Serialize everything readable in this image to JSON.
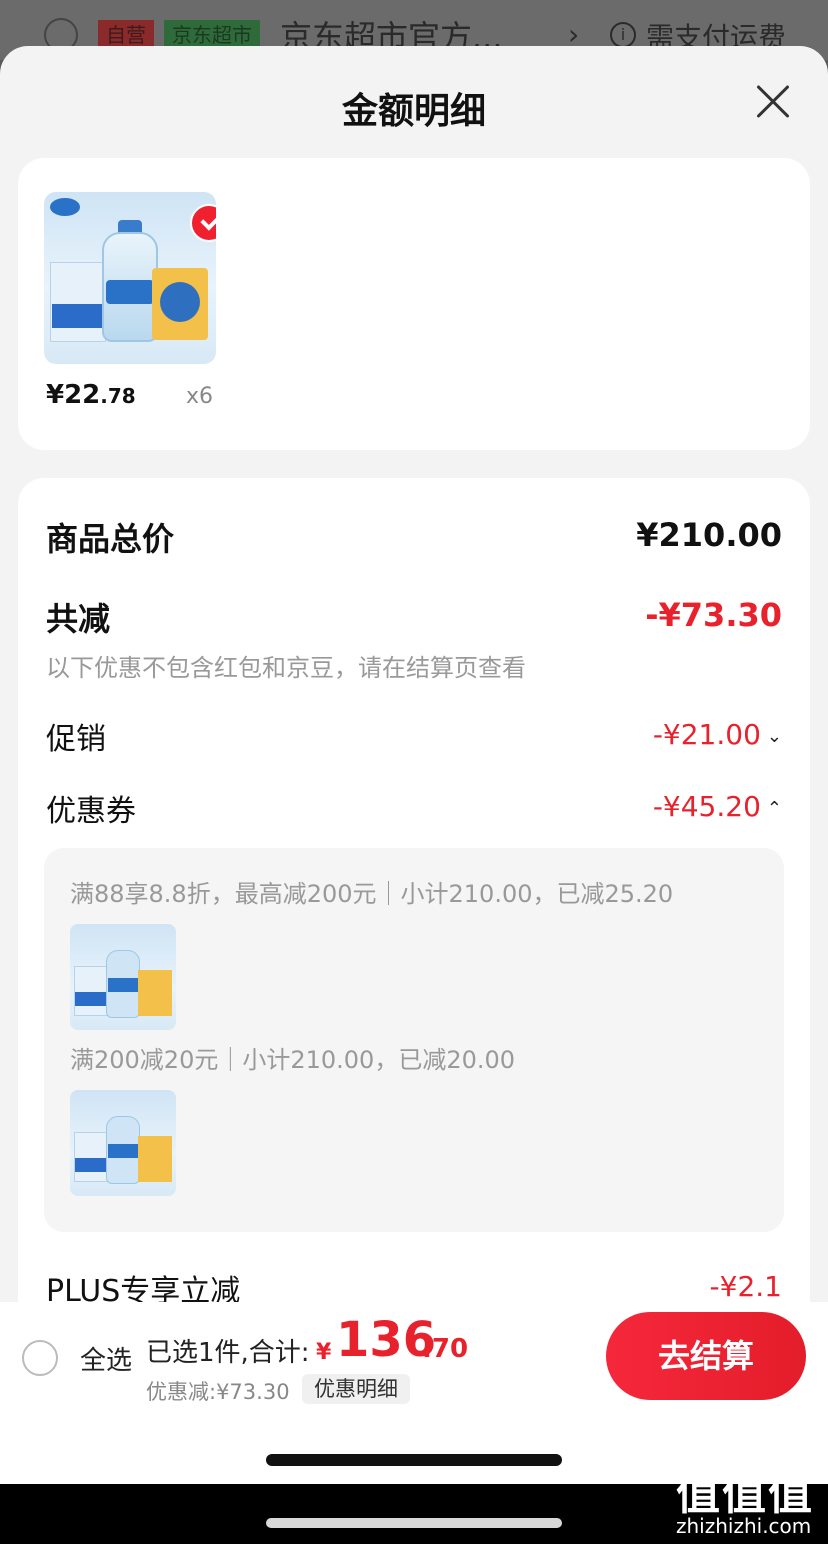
{
  "background": {
    "tag_self": "自营",
    "tag_market": "京东超市",
    "store_name": "京东超市官方...",
    "chevron": "›",
    "info_icon": "i",
    "shipping_note": "需支付运费"
  },
  "sheet": {
    "title": "金额明细",
    "close_icon": "close-icon"
  },
  "product": {
    "price_main": "¥22",
    "price_dec": ".78",
    "quantity": "x6"
  },
  "details": {
    "total_label": "商品总价",
    "total_amount": "¥210.00",
    "reduce_label": "共减",
    "reduce_amount": "-¥73.30",
    "reduce_note": "以下优惠不包含红包和京豆，请在结算页查看",
    "promo_label": "促销",
    "promo_amount": "-¥21.00",
    "coupon_label": "优惠券",
    "coupon_amount": "-¥45.20",
    "plus_label": "PLUS专享立减",
    "plus_amount": "-¥2.1"
  },
  "coupons": [
    {
      "text": "满88享8.8折，最高减200元｜小计210.00，已减25.20"
    },
    {
      "text": "满200减20元｜小计210.00，已减20.00"
    }
  ],
  "bottom": {
    "select_all": "全选",
    "summary": "已选1件,合计:",
    "total_currency": "¥",
    "total_int": "136",
    "total_dec": ".70",
    "discount": "优惠减:¥73.30",
    "detail_chip": "优惠明细",
    "checkout": "去结算"
  },
  "watermark": {
    "glyph": "值值值",
    "domain": "zhizhizhi.com"
  },
  "colors": {
    "accent_red": "#e8222c",
    "sheet_bg": "#f3f3f3"
  }
}
